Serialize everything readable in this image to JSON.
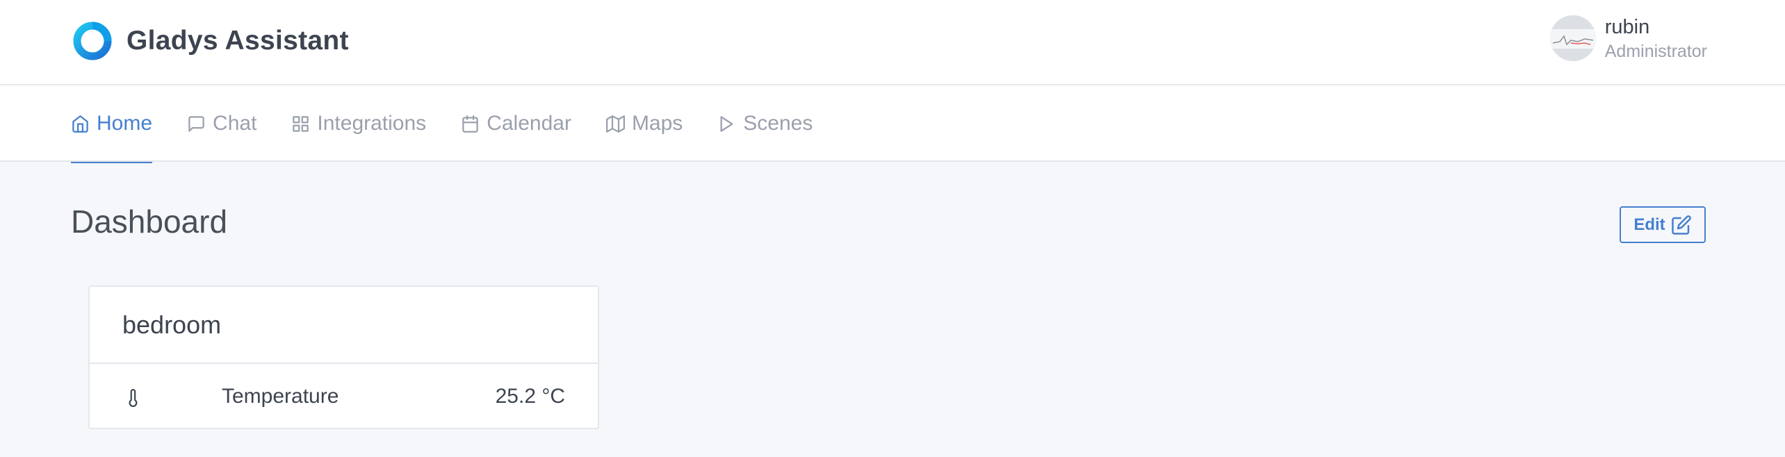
{
  "app": {
    "title": "Gladys Assistant",
    "accent_color": "#467fcf"
  },
  "user": {
    "name": "rubin",
    "role": "Administrator"
  },
  "nav": {
    "items": [
      {
        "label": "Home",
        "icon": "home-icon",
        "active": true
      },
      {
        "label": "Chat",
        "icon": "chat-icon",
        "active": false
      },
      {
        "label": "Integrations",
        "icon": "grid-icon",
        "active": false
      },
      {
        "label": "Calendar",
        "icon": "calendar-icon",
        "active": false
      },
      {
        "label": "Maps",
        "icon": "map-icon",
        "active": false
      },
      {
        "label": "Scenes",
        "icon": "play-icon",
        "active": false
      }
    ]
  },
  "dashboard": {
    "title": "Dashboard",
    "edit_label": "Edit",
    "cards": [
      {
        "title": "bedroom",
        "rows": [
          {
            "icon": "thermometer-icon",
            "label": "Temperature",
            "value": "25.2 °C"
          }
        ]
      }
    ]
  }
}
